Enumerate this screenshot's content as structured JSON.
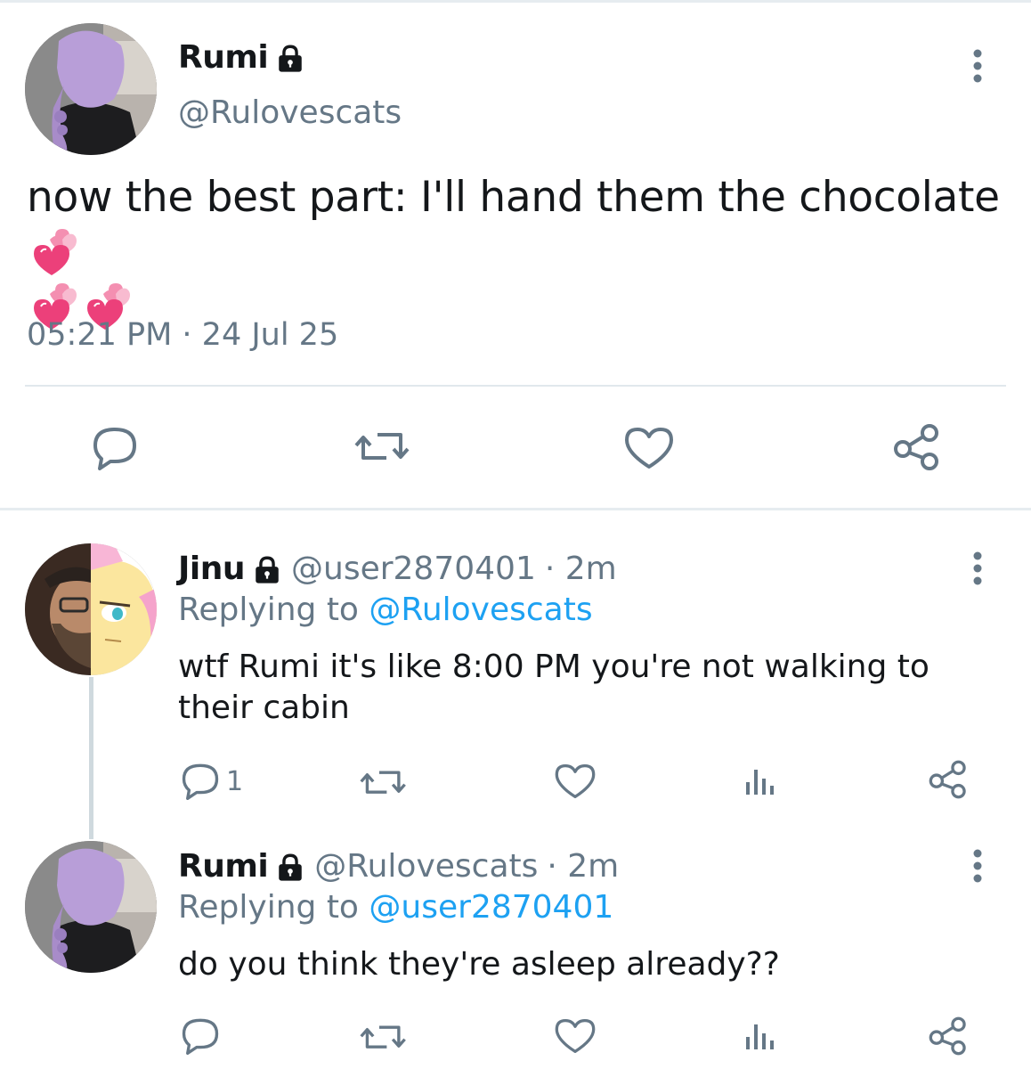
{
  "main_tweet": {
    "display_name": "Rumi",
    "handle": "@Rulovescats",
    "text": "now the best part: I'll hand them the chocolate",
    "emojis": [
      "two-hearts",
      "two-hearts",
      "two-hearts"
    ],
    "timestamp": "05:21 PM · 24 Jul 25",
    "actions": [
      "reply-icon",
      "retweet-icon",
      "like-icon",
      "share-icon"
    ]
  },
  "replies": [
    {
      "display_name": "Jinu",
      "handle": "@user2870401",
      "time": "· 2m",
      "replying_label": "Replying to",
      "replying_to": "@Rulovescats",
      "text": "wtf Rumi it's like 8:00 PM you're not walking to their cabin",
      "reply_count": "1"
    },
    {
      "display_name": "Rumi",
      "handle": "@Rulovescats",
      "time": "· 2m",
      "replying_label": "Replying to",
      "replying_to": "@user2870401",
      "text": "do you think they're asleep already??",
      "reply_count": ""
    }
  ],
  "colors": {
    "text": "#14171a",
    "secondary": "#657786",
    "link": "#1da1f2",
    "divider": "#e1e8ed",
    "heart_pink": "#f06292"
  }
}
